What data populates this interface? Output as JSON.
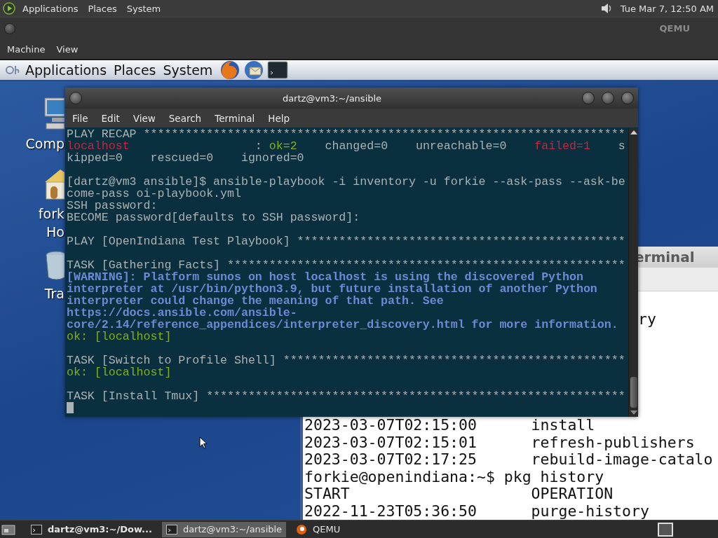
{
  "host_panel": {
    "menus": [
      "Applications",
      "Places",
      "System"
    ],
    "clock": "Tue Mar 7, 12:50 AM"
  },
  "qemu_window": {
    "title": "QEMU",
    "menus": [
      "Machine",
      "View"
    ]
  },
  "guest_panel": {
    "menus": [
      "Applications",
      "Places",
      "System"
    ]
  },
  "desktop_icons": [
    {
      "kind": "computer",
      "label_lines": [
        "Comp"
      ]
    },
    {
      "kind": "home",
      "label_lines": [
        "fork",
        "Ho"
      ]
    },
    {
      "kind": "trash",
      "label_lines": [
        "Tra"
      ]
    }
  ],
  "background_terminal": {
    "title": "erminal",
    "lines": [
      {
        "kind": "fragment",
        "text": "ry"
      },
      {
        "kind": "line",
        "text": "2023-03-07T02:15:00      install"
      },
      {
        "kind": "line",
        "text": "2023-03-07T02:15:01      refresh-publishers"
      },
      {
        "kind": "line",
        "text": "2023-03-07T02:17:25      rebuild-image-catalo"
      },
      {
        "kind": "line",
        "text": "forkie@openindiana:~$ pkg history"
      },
      {
        "kind": "line",
        "text": "START                    OPERATION"
      },
      {
        "kind": "line",
        "text": "2022-11-23T05:36:50      purge-history"
      }
    ]
  },
  "terminal": {
    "title": "dartz@vm3:~/ansible",
    "menus": [
      "File",
      "Edit",
      "View",
      "Search",
      "Terminal",
      "Help"
    ],
    "lines": [
      {
        "kind": "text",
        "segments": [
          {
            "kind": "plain",
            "text": "PLAY RECAP *********************************************************************"
          }
        ]
      },
      {
        "kind": "text",
        "segments": [
          {
            "kind": "error",
            "text": "localhost"
          },
          {
            "kind": "plain",
            "text": "                  : "
          },
          {
            "kind": "ok",
            "text": "ok=2"
          },
          {
            "kind": "plain",
            "text": "    changed=0    unreachable=0    "
          },
          {
            "kind": "error",
            "text": "failed=1"
          },
          {
            "kind": "plain",
            "text": "    s"
          }
        ]
      },
      {
        "kind": "text",
        "segments": [
          {
            "kind": "plain",
            "text": "kipped=0    rescued=0    ignored=0"
          }
        ]
      },
      {
        "kind": "blank"
      },
      {
        "kind": "text",
        "segments": [
          {
            "kind": "plain",
            "text": "[dartz@vm3 ansible]$ ansible-playbook -i inventory -u forkie --ask-pass --ask-be"
          }
        ]
      },
      {
        "kind": "text",
        "segments": [
          {
            "kind": "plain",
            "text": "come-pass oi-playbook.yml"
          }
        ]
      },
      {
        "kind": "text",
        "segments": [
          {
            "kind": "plain",
            "text": "SSH password:"
          }
        ]
      },
      {
        "kind": "text",
        "segments": [
          {
            "kind": "plain",
            "text": "BECOME password[defaults to SSH password]:"
          }
        ]
      },
      {
        "kind": "blank"
      },
      {
        "kind": "text",
        "segments": [
          {
            "kind": "plain",
            "text": "PLAY [OpenIndiana Test Playbook] ***********************************************"
          }
        ]
      },
      {
        "kind": "blank"
      },
      {
        "kind": "text",
        "segments": [
          {
            "kind": "plain",
            "text": "TASK [Gathering Facts] *********************************************************"
          }
        ]
      },
      {
        "kind": "text",
        "segments": [
          {
            "kind": "warning",
            "text": "[WARNING]: Platform sunos on host localhost is using the discovered Python"
          }
        ]
      },
      {
        "kind": "text",
        "segments": [
          {
            "kind": "warning",
            "text": "interpreter at /usr/bin/python3.9, but future installation of another Python"
          }
        ]
      },
      {
        "kind": "text",
        "segments": [
          {
            "kind": "warning",
            "text": "interpreter could change the meaning of that path. See"
          }
        ]
      },
      {
        "kind": "text",
        "segments": [
          {
            "kind": "warning",
            "text": "https://docs.ansible.com/ansible-"
          }
        ]
      },
      {
        "kind": "text",
        "segments": [
          {
            "kind": "warning",
            "text": "core/2.14/reference_appendices/interpreter_discovery.html for more information."
          }
        ]
      },
      {
        "kind": "text",
        "segments": [
          {
            "kind": "ok",
            "text": "ok: [localhost]"
          }
        ]
      },
      {
        "kind": "blank"
      },
      {
        "kind": "text",
        "segments": [
          {
            "kind": "plain",
            "text": "TASK [Switch to Profile Shell] *************************************************"
          }
        ]
      },
      {
        "kind": "text",
        "segments": [
          {
            "kind": "ok",
            "text": "ok: [localhost]"
          }
        ]
      },
      {
        "kind": "blank"
      },
      {
        "kind": "text",
        "segments": [
          {
            "kind": "plain",
            "text": "TASK [Install Tmux] ************************************************************"
          }
        ]
      },
      {
        "kind": "cursor"
      }
    ]
  },
  "taskbar": {
    "tasks": [
      {
        "kind": "terminal",
        "label": "dartz@vm3:~/Dow...",
        "bold": true,
        "selected": false
      },
      {
        "kind": "terminal",
        "label": "dartz@vm3:~/ansible",
        "bold": false,
        "selected": true
      },
      {
        "kind": "qemu",
        "label": "QEMU",
        "bold": false,
        "selected": false
      }
    ]
  }
}
